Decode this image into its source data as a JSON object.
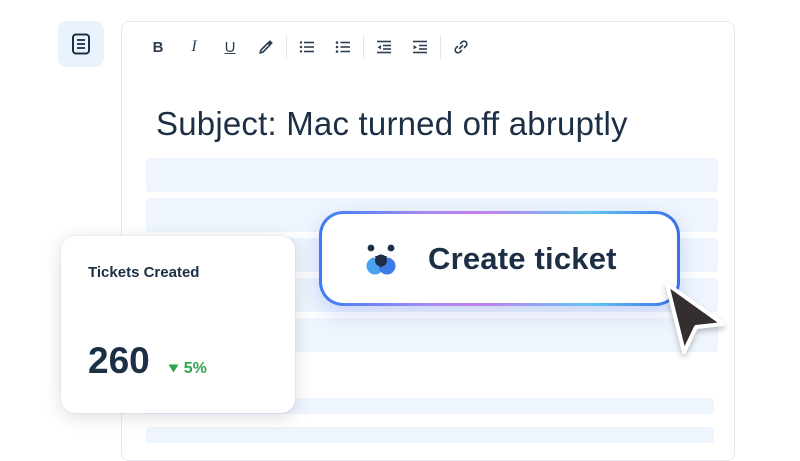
{
  "editor": {
    "subject": "Subject: Mac turned off abruptly"
  },
  "toolbar": {
    "bold": "B",
    "italic": "I",
    "underline": "U"
  },
  "stats": {
    "title": "Tickets Created",
    "value": "260",
    "delta": "5%",
    "delta_color": "#2ea44f"
  },
  "cta": {
    "label": "Create ticket",
    "accent": "#3a7cf5"
  },
  "colors": {
    "text": "#1c2f45",
    "placeholder": "#eef5fd",
    "rail_bg": "#eaf3fd"
  }
}
